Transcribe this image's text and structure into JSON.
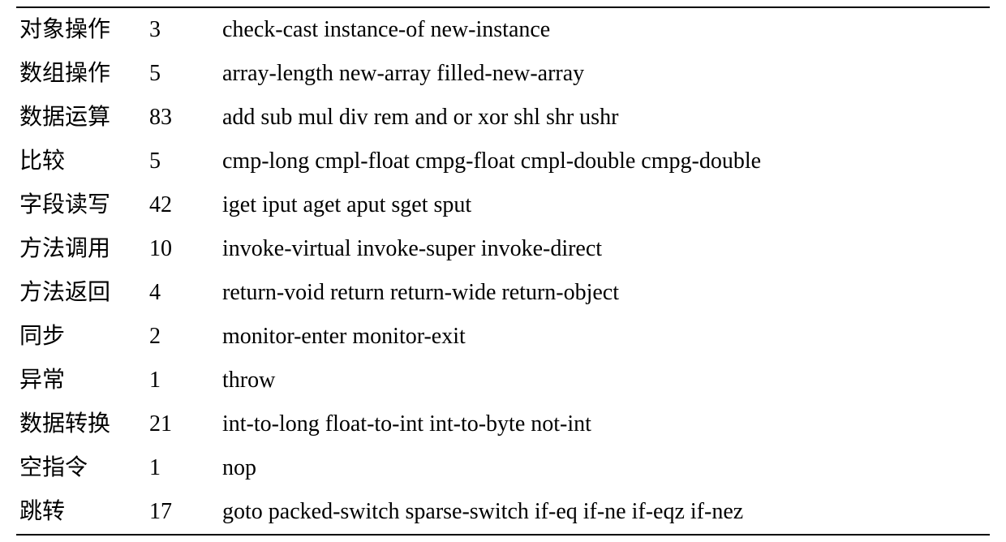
{
  "rows": [
    {
      "category": "对象操作",
      "count": "3",
      "examples": "check-cast instance-of new-instance"
    },
    {
      "category": "数组操作",
      "count": "5",
      "examples": "array-length new-array filled-new-array"
    },
    {
      "category": "数据运算",
      "count": "83",
      "examples": "add sub mul div rem and or xor shl shr ushr"
    },
    {
      "category": "比较",
      "count": "5",
      "examples": "cmp-long cmpl-float cmpg-float cmpl-double cmpg-double"
    },
    {
      "category": "字段读写",
      "count": "42",
      "examples": "iget iput aget aput sget sput"
    },
    {
      "category": "方法调用",
      "count": "10",
      "examples": "invoke-virtual invoke-super invoke-direct"
    },
    {
      "category": "方法返回",
      "count": "4",
      "examples": "return-void return return-wide return-object"
    },
    {
      "category": "同步",
      "count": "2",
      "examples": "monitor-enter monitor-exit"
    },
    {
      "category": "异常",
      "count": "1",
      "examples": "throw"
    },
    {
      "category": "数据转换",
      "count": "21",
      "examples": "int-to-long float-to-int int-to-byte not-int"
    },
    {
      "category": "空指令",
      "count": "1",
      "examples": "nop"
    },
    {
      "category": "跳转",
      "count": "17",
      "examples": "goto packed-switch sparse-switch if-eq if-ne if-eqz if-nez"
    }
  ]
}
